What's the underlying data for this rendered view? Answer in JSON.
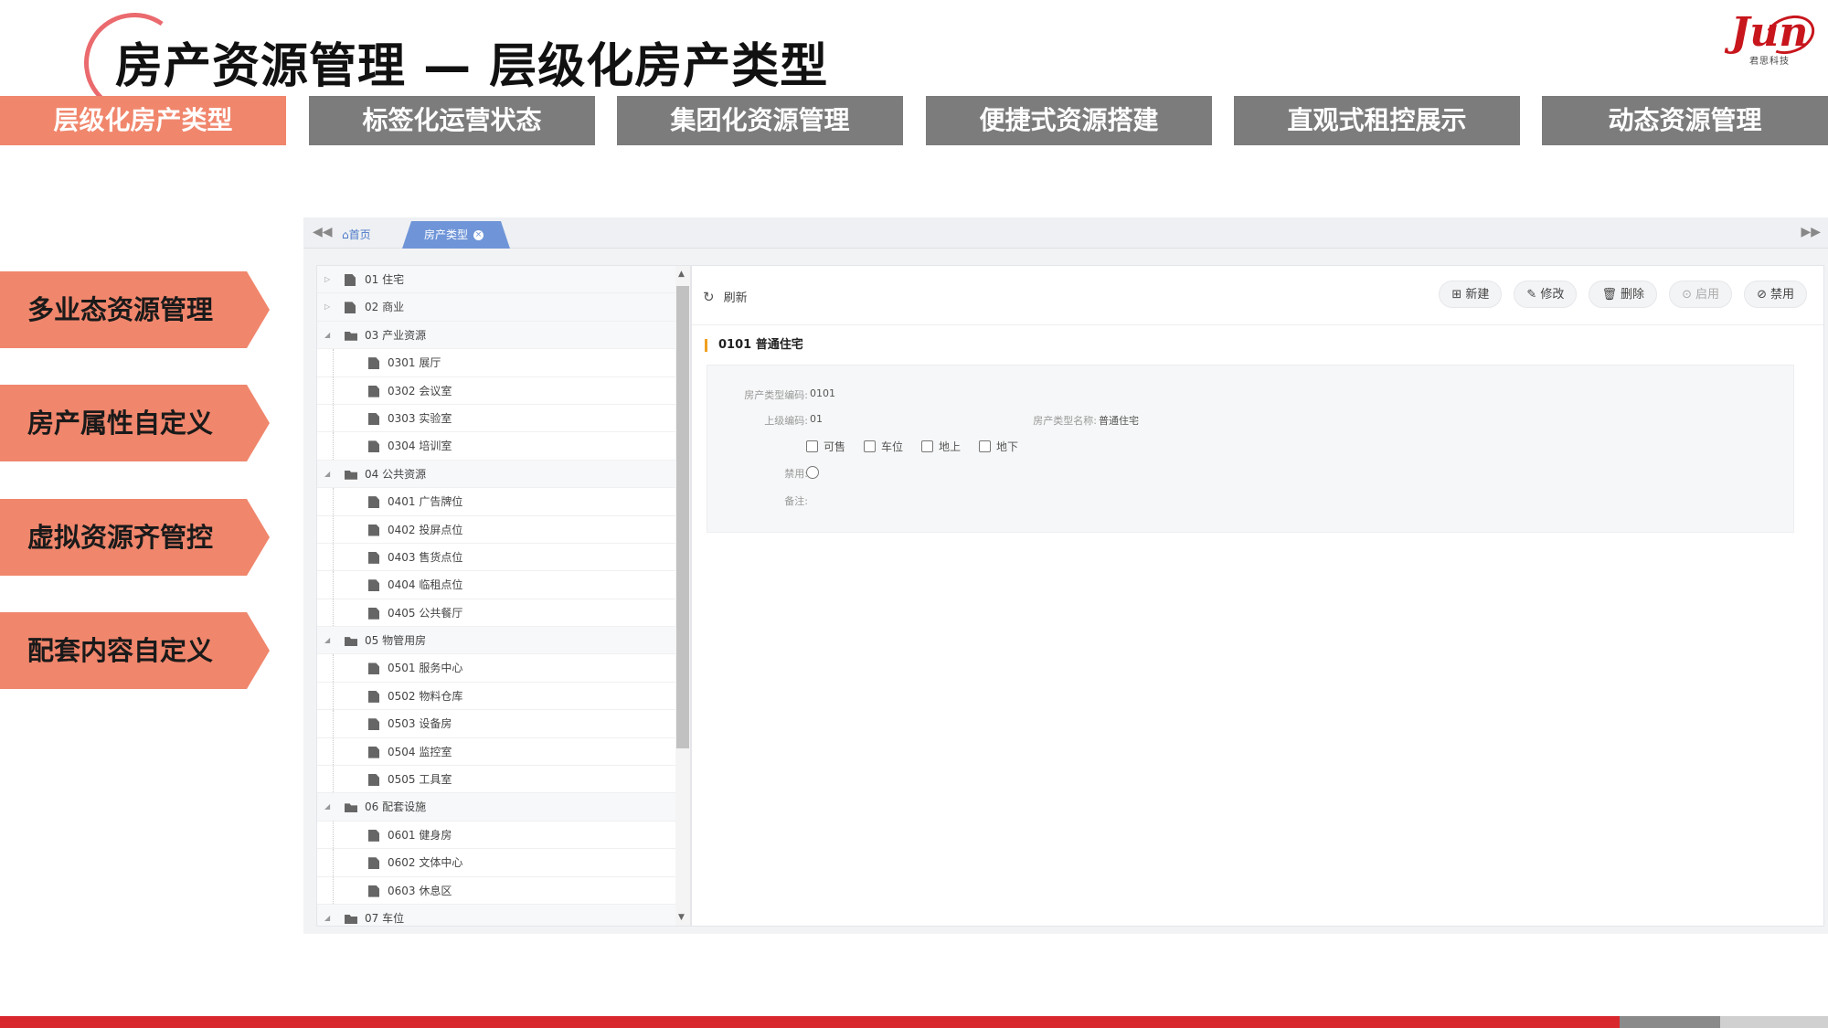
{
  "title": "房产资源管理 — 层级化房产类型",
  "logo": {
    "main": "Jun",
    "sub": "君思科技"
  },
  "top_tabs": [
    "层级化房产类型",
    "标签化运营状态",
    "集团化资源管理",
    "便捷式资源搭建",
    "直观式租控展示",
    "动态资源管理"
  ],
  "active_top_tab": 0,
  "side_features": [
    "多业态资源管理",
    "房产属性自定义",
    "虚拟资源齐管控",
    "配套内容自定义"
  ],
  "app": {
    "home_tab": "首页",
    "active_tab": "房产类型",
    "tree": [
      {
        "label": "01 住宅",
        "level": 0,
        "type": "file",
        "expand": "collapsed"
      },
      {
        "label": "02 商业",
        "level": 0,
        "type": "file",
        "expand": "collapsed"
      },
      {
        "label": "03 产业资源",
        "level": 0,
        "type": "folder",
        "expand": "expanded"
      },
      {
        "label": "0301 展厅",
        "level": 1,
        "type": "file"
      },
      {
        "label": "0302 会议室",
        "level": 1,
        "type": "file"
      },
      {
        "label": "0303 实验室",
        "level": 1,
        "type": "file"
      },
      {
        "label": "0304 培训室",
        "level": 1,
        "type": "file"
      },
      {
        "label": "04 公共资源",
        "level": 0,
        "type": "folder",
        "expand": "expanded"
      },
      {
        "label": "0401 广告牌位",
        "level": 1,
        "type": "file"
      },
      {
        "label": "0402 投屏点位",
        "level": 1,
        "type": "file"
      },
      {
        "label": "0403 售货点位",
        "level": 1,
        "type": "file"
      },
      {
        "label": "0404 临租点位",
        "level": 1,
        "type": "file"
      },
      {
        "label": "0405 公共餐厅",
        "level": 1,
        "type": "file"
      },
      {
        "label": "05 物管用房",
        "level": 0,
        "type": "folder",
        "expand": "expanded"
      },
      {
        "label": "0501 服务中心",
        "level": 1,
        "type": "file"
      },
      {
        "label": "0502 物料仓库",
        "level": 1,
        "type": "file"
      },
      {
        "label": "0503 设备房",
        "level": 1,
        "type": "file"
      },
      {
        "label": "0504 监控室",
        "level": 1,
        "type": "file"
      },
      {
        "label": "0505 工具室",
        "level": 1,
        "type": "file"
      },
      {
        "label": "06 配套设施",
        "level": 0,
        "type": "folder",
        "expand": "expanded"
      },
      {
        "label": "0601 健身房",
        "level": 1,
        "type": "file"
      },
      {
        "label": "0602 文体中心",
        "level": 1,
        "type": "file"
      },
      {
        "label": "0603 休息区",
        "level": 1,
        "type": "file"
      },
      {
        "label": "07 车位",
        "level": 0,
        "type": "folder",
        "expand": "expanded"
      }
    ],
    "refresh_label": "刷新",
    "toolbar": {
      "new": "新建",
      "edit": "修改",
      "delete": "删除",
      "enable": "启用",
      "disable": "禁用"
    },
    "section_title": "0101 普通住宅",
    "form": {
      "code_label": "房产类型编码:",
      "code_value": "0101",
      "parent_label": "上级编码:",
      "parent_value": "01",
      "name_label": "房产类型名称:",
      "name_value": "普通住宅",
      "checkboxes": [
        "可售",
        "车位",
        "地上",
        "地下"
      ],
      "disabled_label": "禁用:",
      "remark_label": "备注:"
    }
  }
}
